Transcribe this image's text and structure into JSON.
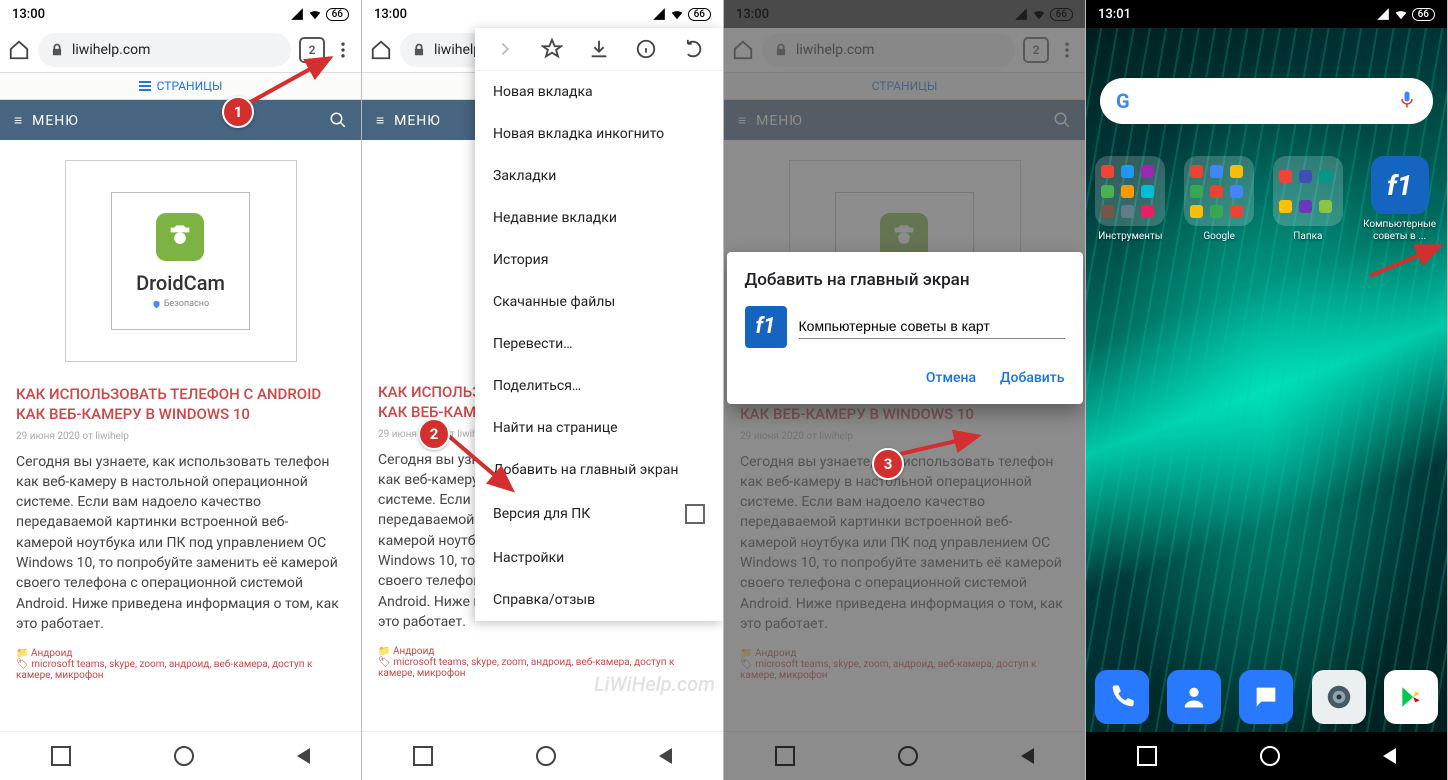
{
  "status": {
    "time1": "13:00",
    "time4": "13:01",
    "battery": "66"
  },
  "browser": {
    "url": "liwihelp.com",
    "tab_count": "2"
  },
  "tabs_label": "СТРАНИЦЫ",
  "menu_label": "МЕНЮ",
  "article": {
    "brand": "DroidCam",
    "safe": "Безопасно",
    "title": "КАК ИСПОЛЬЗОВАТЬ ТЕЛЕФОН С ANDROID КАК ВЕБ-КАМЕРУ В WINDOWS 10",
    "date": "29 июня 2020 от liwihelp",
    "body": "Сегодня вы узнаете, как использовать телефон как веб-камеру в настольной операционной системе. Если вам надоело качество передаваемой картинки встроенной веб-камерой ноутбука или ПК под управлением ОС Windows 10, то попробуйте заменить её камерой своего телефона с операционной системой Android. Ниже приведена информация о том, как это работает.",
    "cat_label": "Андроид",
    "tags_label": "microsoft teams, skype, zoom, андроид, веб-камера, доступ к камере, микрофон"
  },
  "chrome_menu": {
    "new_tab": "Новая вкладка",
    "incognito": "Новая вкладка инкогнито",
    "bookmarks": "Закладки",
    "recent": "Недавние вкладки",
    "history": "История",
    "downloads": "Скачанные файлы",
    "translate": "Перевести…",
    "share": "Поделиться…",
    "find": "Найти на странице",
    "add_home": "Добавить на главный экран",
    "desktop": "Версия для ПК",
    "settings": "Настройки",
    "help": "Справка/отзыв"
  },
  "dialog": {
    "title": "Добавить на главный экран",
    "input_value": "Компьютерные советы в карт",
    "cancel": "Отмена",
    "add": "Добавить"
  },
  "home": {
    "folders": [
      "Инструменты",
      "Google",
      "Папка"
    ],
    "shortcut": "Компьютерные советы в ..."
  },
  "steps": {
    "s1": "1",
    "s2": "2",
    "s3": "3"
  },
  "watermark": "LiWiHelp.com"
}
